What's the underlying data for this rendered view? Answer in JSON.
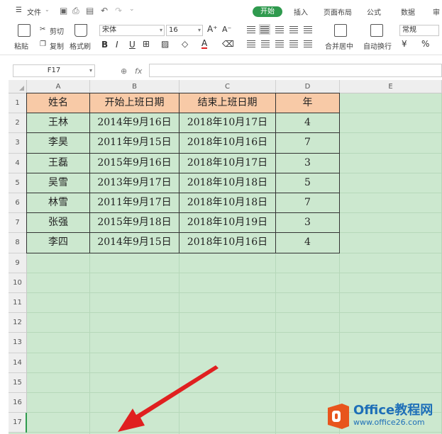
{
  "menu": {
    "file": "文件",
    "tabs": [
      "开始",
      "插入",
      "页面布局",
      "公式",
      "数据",
      "审"
    ]
  },
  "toolbar": {
    "paste": "粘贴",
    "cut": "剪切",
    "copy": "复制",
    "format_painter": "格式刷",
    "font_name": "宋体",
    "font_size": "16",
    "bold": "B",
    "italic": "I",
    "underline": "U",
    "font_color_label": "A",
    "merge_center": "合并居中",
    "wrap_text": "自动换行",
    "number_format": "常规",
    "percent": "%"
  },
  "formula_bar": {
    "name_box": "F17",
    "fx": "fx"
  },
  "sheet": {
    "columns": [
      "A",
      "B",
      "C",
      "D",
      "E"
    ],
    "rows": [
      "1",
      "2",
      "3",
      "4",
      "5",
      "6",
      "7",
      "8",
      "9",
      "10",
      "11",
      "12",
      "13",
      "14",
      "15",
      "16",
      "17"
    ],
    "active_row": "17",
    "header": [
      "姓名",
      "开始上班日期",
      "结束上班日期",
      "年"
    ],
    "data": [
      [
        "王林",
        "2014年9月16日",
        "2018年10月17日",
        "4"
      ],
      [
        "李昊",
        "2011年9月15日",
        "2018年10月16日",
        "7"
      ],
      [
        "王磊",
        "2015年9月16日",
        "2018年10月17日",
        "3"
      ],
      [
        "吴雪",
        "2013年9月17日",
        "2018年10月18日",
        "5"
      ],
      [
        "林雪",
        "2011年9月17日",
        "2018年10月18日",
        "7"
      ],
      [
        "张强",
        "2015年9月18日",
        "2018年10月19日",
        "3"
      ],
      [
        "李四",
        "2014年9月15日",
        "2018年10月16日",
        "4"
      ]
    ],
    "colors": {
      "header_fill": "#f8caa7",
      "sheet_background": "#cce8cf",
      "accent": "#2f9a4e"
    }
  },
  "watermark": {
    "brand": "Office教程网",
    "url": "www.office26.com"
  }
}
